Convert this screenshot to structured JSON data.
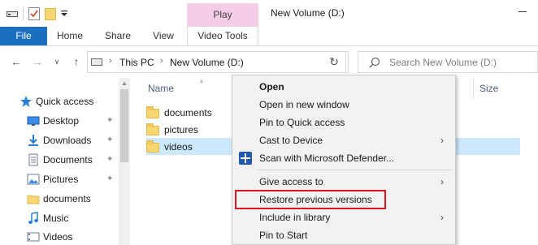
{
  "window": {
    "title": "New Volume (D:)"
  },
  "ribbon": {
    "context_tab": "Play",
    "tabs": [
      "File",
      "Home",
      "Share",
      "View",
      "Video Tools"
    ]
  },
  "address": {
    "segments": [
      "This PC",
      "New Volume (D:)"
    ]
  },
  "search": {
    "placeholder": "Search New Volume (D:)"
  },
  "navpane": {
    "items": [
      {
        "label": "Quick access",
        "icon": "star-icon"
      },
      {
        "label": "Desktop",
        "icon": "desktop-folder-icon",
        "pinned": true
      },
      {
        "label": "Downloads",
        "icon": "download-icon",
        "pinned": true
      },
      {
        "label": "Documents",
        "icon": "documents-icon",
        "pinned": true
      },
      {
        "label": "Pictures",
        "icon": "pictures-icon",
        "pinned": true
      },
      {
        "label": "documents",
        "icon": "folder-icon"
      },
      {
        "label": "Music",
        "icon": "music-icon"
      },
      {
        "label": "Videos",
        "icon": "videos-icon"
      }
    ]
  },
  "filelist": {
    "columns": {
      "name": "Name",
      "size": "Size"
    },
    "rows": [
      {
        "name": "documents",
        "selected": false
      },
      {
        "name": "pictures",
        "selected": false
      },
      {
        "name": "videos",
        "selected": true
      }
    ]
  },
  "context_menu": {
    "items": [
      {
        "label": "Open",
        "bold": true
      },
      {
        "label": "Open in new window"
      },
      {
        "label": "Pin to Quick access"
      },
      {
        "label": "Cast to Device",
        "submenu": true
      },
      {
        "label": "Scan with Microsoft Defender...",
        "icon": "defender-icon"
      },
      {
        "label": "Give access to",
        "submenu": true
      },
      {
        "label": "Restore previous versions",
        "highlighted": true
      },
      {
        "label": "Include in library",
        "submenu": true
      },
      {
        "label": "Pin to Start"
      }
    ],
    "highlight_color": "#e0141e"
  },
  "colors": {
    "file_tab": "#1a6fc0",
    "play_tab": "#f6cde6",
    "selection": "#cce8ff"
  }
}
